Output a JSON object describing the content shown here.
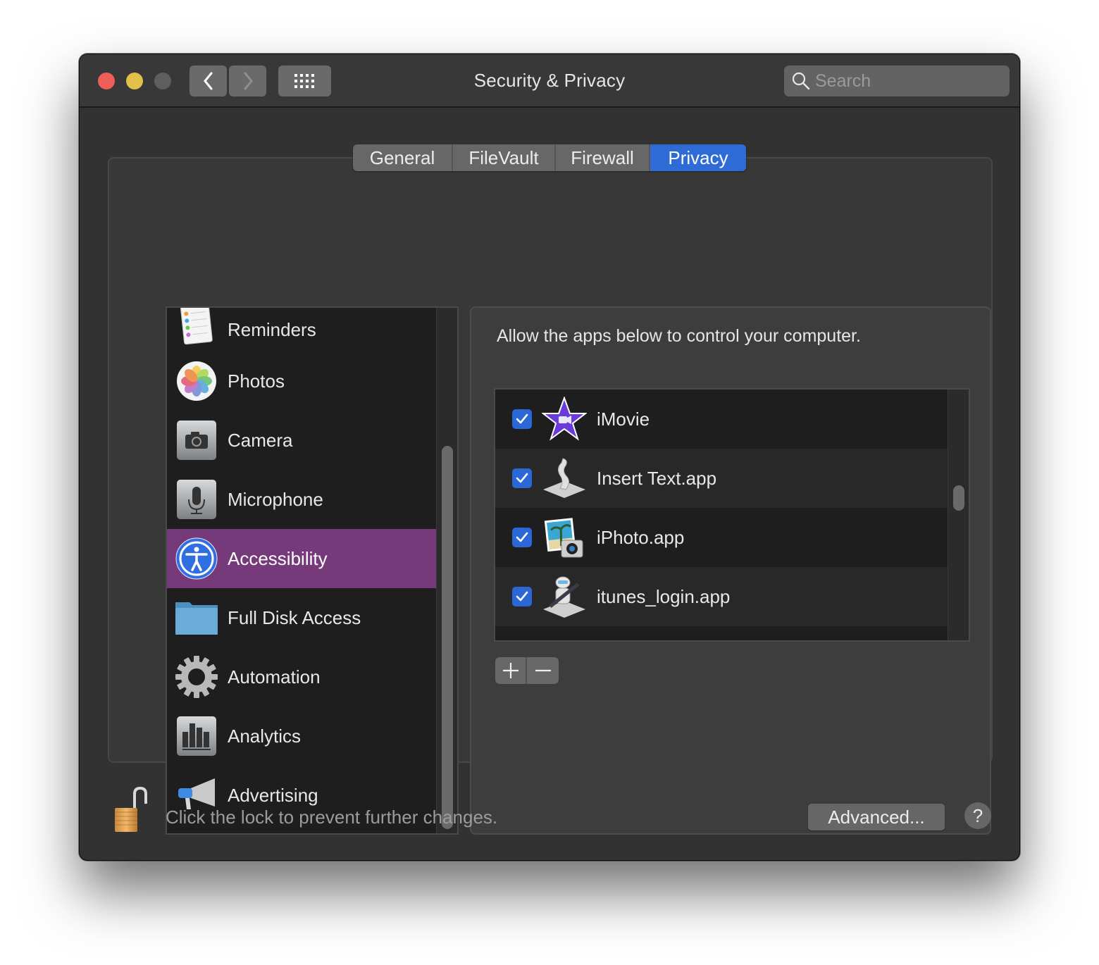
{
  "window": {
    "title": "Security & Privacy",
    "controls": [
      "close",
      "minimize",
      "zoom"
    ],
    "nav": {
      "back_icon": "chevron-left-icon",
      "forward_icon": "chevron-right-icon",
      "grid_icon": "grid-icon"
    }
  },
  "search": {
    "placeholder": "Search",
    "value": "",
    "icon": "search-icon"
  },
  "tabs": [
    {
      "label": "General",
      "active": false
    },
    {
      "label": "FileVault",
      "active": false
    },
    {
      "label": "Firewall",
      "active": false
    },
    {
      "label": "Privacy",
      "active": true
    }
  ],
  "sidebar": {
    "items": [
      {
        "label": "Reminders",
        "icon": "reminders-icon",
        "selected": false
      },
      {
        "label": "Photos",
        "icon": "photos-icon",
        "selected": false
      },
      {
        "label": "Camera",
        "icon": "camera-icon",
        "selected": false
      },
      {
        "label": "Microphone",
        "icon": "microphone-icon",
        "selected": false
      },
      {
        "label": "Accessibility",
        "icon": "accessibility-icon",
        "selected": true
      },
      {
        "label": "Full Disk Access",
        "icon": "folder-icon",
        "selected": false
      },
      {
        "label": "Automation",
        "icon": "gear-icon",
        "selected": false
      },
      {
        "label": "Analytics",
        "icon": "analytics-icon",
        "selected": false
      },
      {
        "label": "Advertising",
        "icon": "megaphone-icon",
        "selected": false
      }
    ]
  },
  "panel": {
    "description": "Allow the apps below to control your computer.",
    "apps": [
      {
        "name": "iMovie",
        "checked": true,
        "icon": "imovie-icon"
      },
      {
        "name": "Insert Text.app",
        "checked": true,
        "icon": "script-icon"
      },
      {
        "name": "iPhoto.app",
        "checked": true,
        "icon": "iphoto-icon"
      },
      {
        "name": "itunes_login.app",
        "checked": true,
        "icon": "automator-icon"
      },
      {
        "name": "",
        "checked": null,
        "icon": "itunes-icon"
      }
    ],
    "add_label": "+",
    "remove_label": "−"
  },
  "footer": {
    "lock_text": "Click the lock to prevent further changes.",
    "lock_state": "unlocked",
    "advanced_label": "Advanced...",
    "help_label": "?"
  },
  "colors": {
    "accent": "#2e6bd6",
    "selection": "#763a7a",
    "checkbox": "#2c67d8"
  }
}
